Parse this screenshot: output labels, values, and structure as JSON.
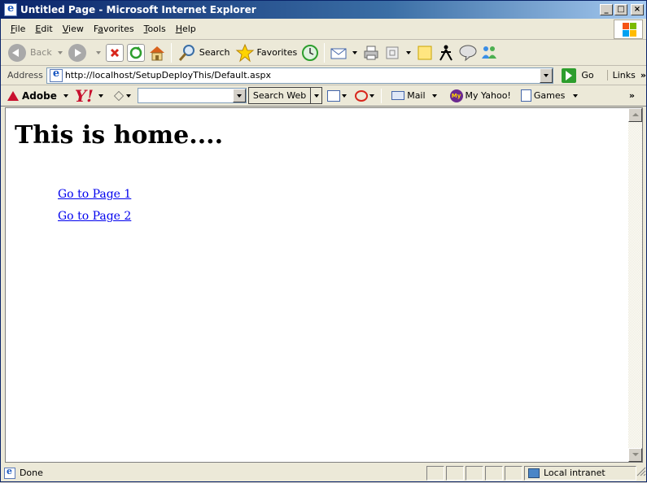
{
  "window": {
    "title": "Untitled Page - Microsoft Internet Explorer",
    "controls": {
      "minimize": "_",
      "maximize": "□",
      "close": "×"
    }
  },
  "menu": {
    "file": {
      "u": "F",
      "rest": "ile"
    },
    "edit": {
      "u": "E",
      "rest": "dit"
    },
    "view": {
      "u": "V",
      "rest": "iew"
    },
    "favorites": {
      "u": "a",
      "pre": "F",
      "rest": "vorites"
    },
    "tools": {
      "u": "T",
      "rest": "ools"
    },
    "help": {
      "u": "H",
      "rest": "elp"
    }
  },
  "toolbar": {
    "back": "Back",
    "search": "Search",
    "favorites": "Favorites"
  },
  "address": {
    "label": "Address",
    "url": "http://localhost/SetupDeployThis/Default.aspx",
    "go": "Go",
    "links": "Links",
    "more": "»"
  },
  "yahoo_toolbar": {
    "adobe": "Adobe",
    "yahoo": "Y!",
    "search_button": "Search Web",
    "mail": "Mail",
    "my_yahoo_badge": "My",
    "my_yahoo": "My Yahoo!",
    "games": "Games",
    "more": "»"
  },
  "page": {
    "heading": "This is home....",
    "links": [
      "Go to Page 1",
      "Go to Page 2"
    ]
  },
  "status": {
    "text": "Done",
    "zone": "Local intranet"
  },
  "colors": {
    "titlebar_start": "#0a246a",
    "link": "#0000ee",
    "yahoo_red": "#c8102e"
  }
}
